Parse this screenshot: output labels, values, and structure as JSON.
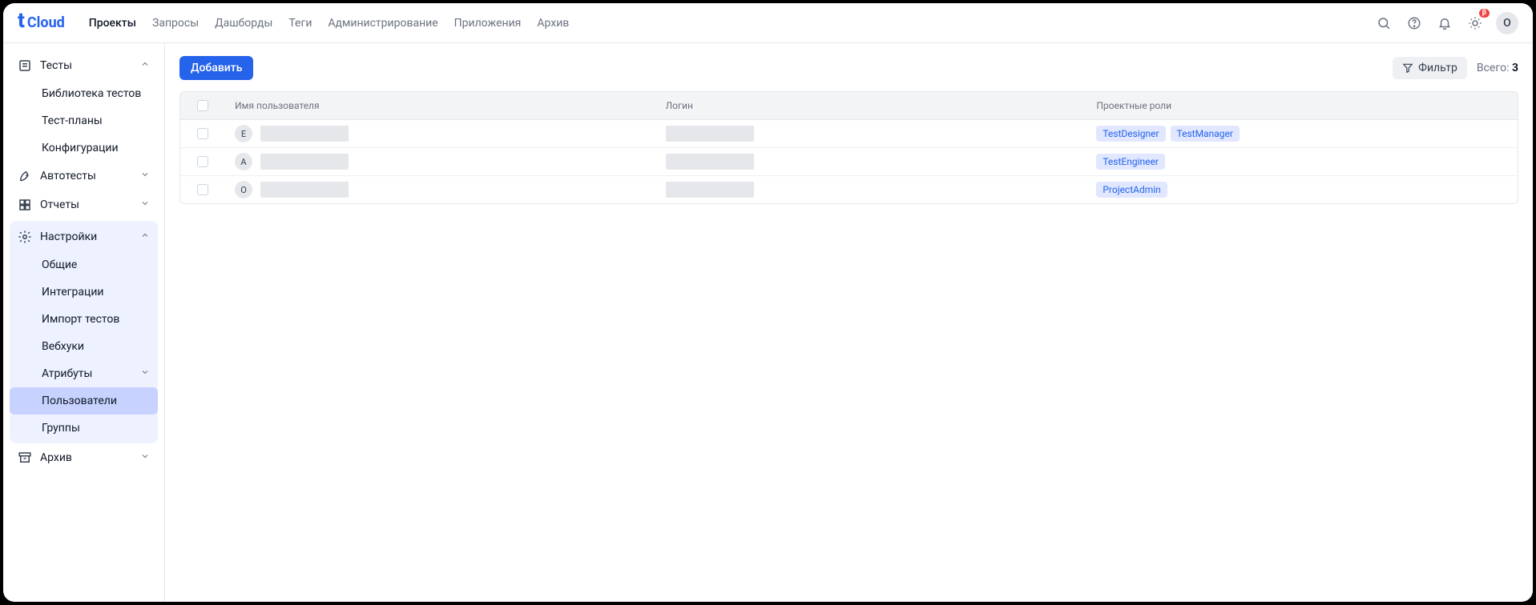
{
  "logo": {
    "text": "Cloud"
  },
  "topnav": [
    "Проекты",
    "Запросы",
    "Дашборды",
    "Теги",
    "Администрирование",
    "Приложения",
    "Архив"
  ],
  "betaBadge": "β",
  "avatarLetter": "O",
  "sidebar": {
    "tests": {
      "label": "Тесты",
      "children": [
        "Библиотека тестов",
        "Тест-планы",
        "Конфигурации"
      ]
    },
    "autotests": {
      "label": "Автотесты"
    },
    "reports": {
      "label": "Отчеты"
    },
    "settings": {
      "label": "Настройки",
      "children": [
        "Общие",
        "Интеграции",
        "Импорт тестов",
        "Вебхуки",
        "Атрибуты",
        "Пользователи",
        "Группы"
      ]
    },
    "archive": {
      "label": "Архив"
    }
  },
  "toolbar": {
    "add": "Добавить",
    "filter": "Фильтр",
    "totalLabel": "Всего:",
    "totalValue": "3"
  },
  "table": {
    "headers": {
      "username": "Имя пользователя",
      "login": "Логин",
      "roles": "Проектные роли"
    },
    "rows": [
      {
        "avatar": "E",
        "roles": [
          "TestDesigner",
          "TestManager"
        ]
      },
      {
        "avatar": "A",
        "roles": [
          "TestEngineer"
        ]
      },
      {
        "avatar": "O",
        "roles": [
          "ProjectAdmin"
        ]
      }
    ]
  }
}
